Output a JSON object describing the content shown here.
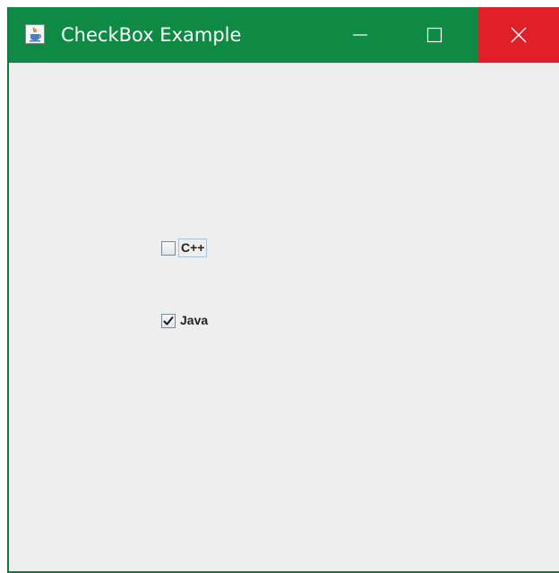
{
  "window": {
    "title": "CheckBox Example",
    "titlebar_color": "#0f8a44",
    "close_color": "#e11f29",
    "icons": {
      "app": "java-app-icon",
      "minimize": "minimize-icon",
      "maximize": "maximize-icon",
      "close": "close-icon"
    }
  },
  "checkboxes": [
    {
      "label": "C++",
      "checked": false,
      "focused": true
    },
    {
      "label": "Java",
      "checked": true,
      "focused": false
    }
  ]
}
